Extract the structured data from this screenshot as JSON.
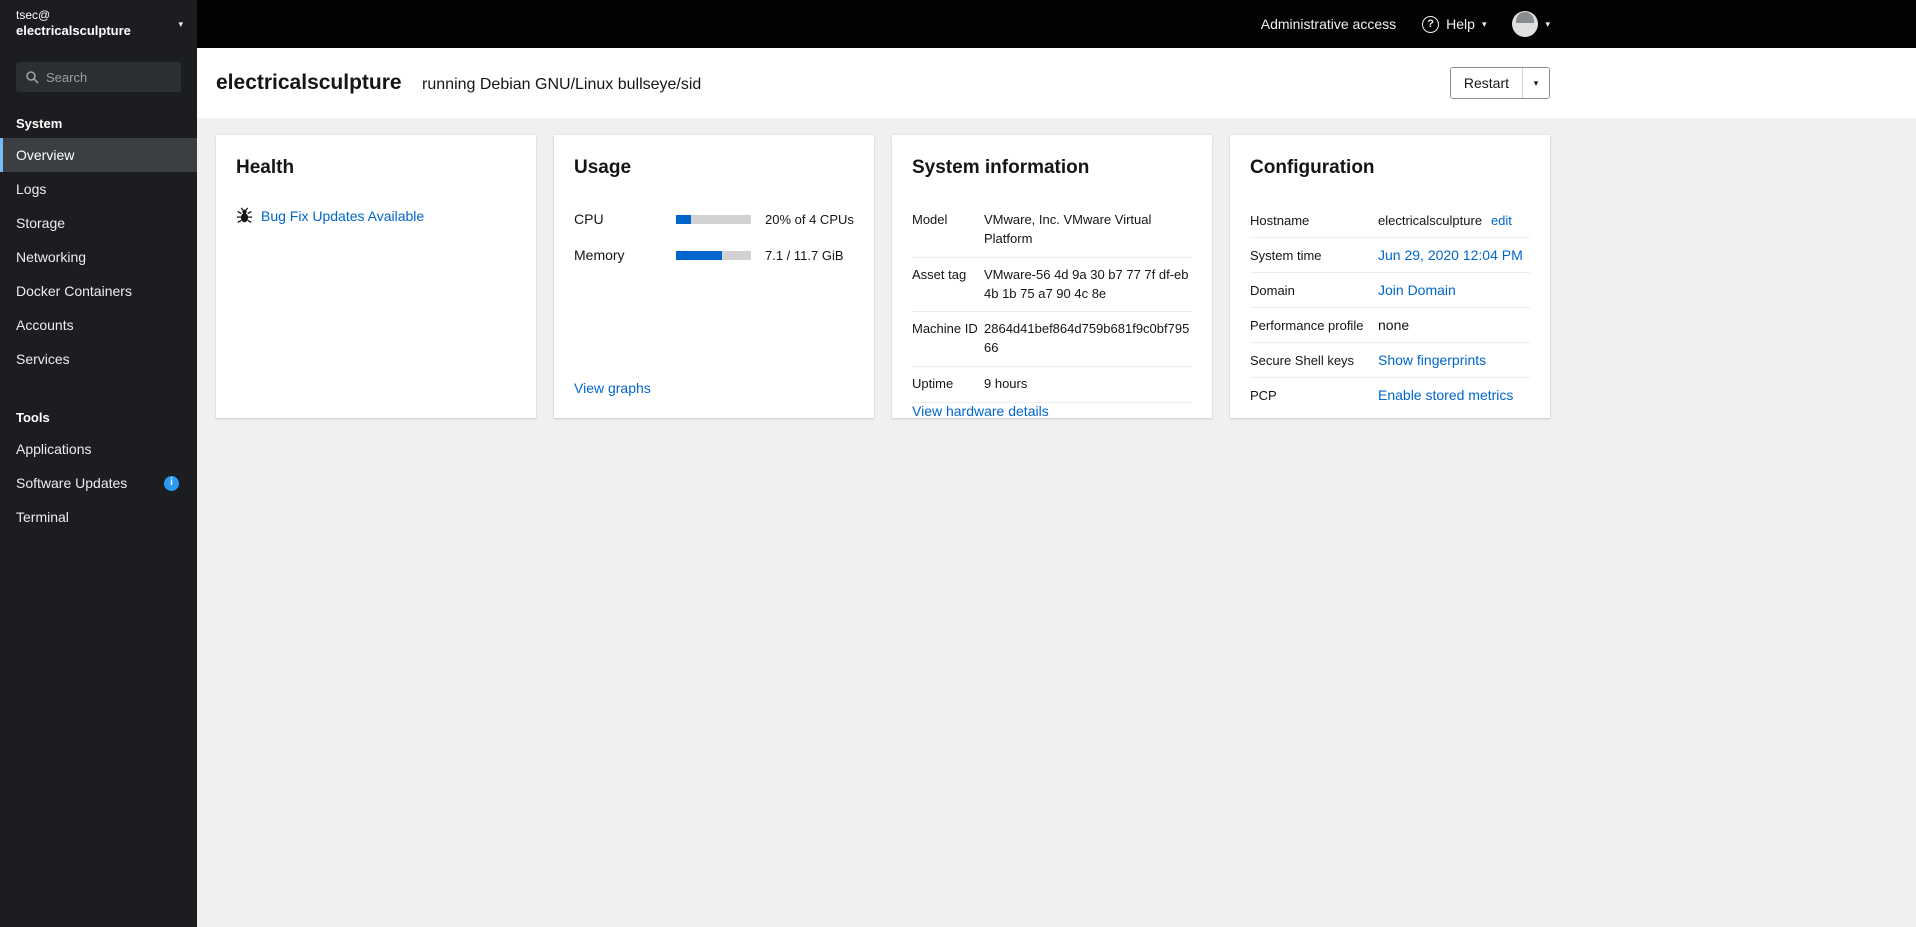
{
  "colors": {
    "accent": "#0066cc",
    "link": "#0066cc",
    "topbar_bg": "#030303",
    "sidebar_bg": "#1b1d21",
    "active_indicator": "#73bcf7",
    "info_badge": "#2b9af3",
    "progress_fill": "#0066cc",
    "progress_track": "#d2d2d2"
  },
  "sidebar": {
    "user": "tsec@",
    "host": "electricalsculpture",
    "search_placeholder": "Search",
    "sections": [
      {
        "label": "System",
        "items": [
          {
            "label": "Overview",
            "active": true
          },
          {
            "label": "Logs"
          },
          {
            "label": "Storage"
          },
          {
            "label": "Networking"
          },
          {
            "label": "Docker Containers"
          },
          {
            "label": "Accounts"
          },
          {
            "label": "Services"
          }
        ]
      },
      {
        "label": "Tools",
        "items": [
          {
            "label": "Applications"
          },
          {
            "label": "Software Updates",
            "badge": "info"
          },
          {
            "label": "Terminal"
          }
        ]
      }
    ]
  },
  "topbar": {
    "admin_access_label": "Administrative access",
    "help_label": "Help",
    "help_icon_glyph": "?"
  },
  "masthead": {
    "hostname": "electricalsculpture",
    "os_text": "running Debian GNU/Linux bullseye/sid",
    "restart_label": "Restart"
  },
  "health": {
    "title": "Health",
    "update_link": "Bug Fix Updates Available"
  },
  "usage": {
    "title": "Usage",
    "rows": [
      {
        "label": "CPU",
        "value": "20% of 4 CPUs",
        "percent": 20
      },
      {
        "label": "Memory",
        "value": "7.1 / 11.7 GiB",
        "percent": 61
      }
    ],
    "footer_link": "View graphs"
  },
  "system_info": {
    "title": "System information",
    "rows": [
      {
        "label": "Model",
        "value": "VMware, Inc. VMware Virtual Platform"
      },
      {
        "label": "Asset tag",
        "value": "VMware-56 4d 9a 30 b7 77 7f df-eb 4b 1b 75 a7 90 4c 8e"
      },
      {
        "label": "Machine ID",
        "value": "2864d41bef864d759b681f9c0bf79566"
      },
      {
        "label": "Uptime",
        "value": "9 hours"
      }
    ],
    "footer_link": "View hardware details"
  },
  "configuration": {
    "title": "Configuration",
    "rows": [
      {
        "label": "Hostname",
        "value": "electricalsculpture",
        "link": "edit"
      },
      {
        "label": "System time",
        "link": "Jun 29, 2020 12:04 PM"
      },
      {
        "label": "Domain",
        "link": "Join Domain"
      },
      {
        "label": "Performance profile",
        "value": "none"
      },
      {
        "label": "Secure Shell keys",
        "link": "Show fingerprints"
      },
      {
        "label": "PCP",
        "link": "Enable stored metrics"
      }
    ]
  }
}
